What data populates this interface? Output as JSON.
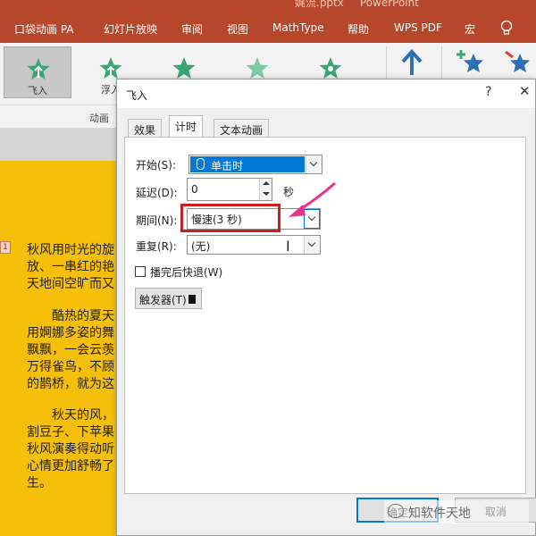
{
  "window": {
    "title_visible": [
      "娓流.pptx",
      "PowerPoint"
    ]
  },
  "menu": {
    "items": [
      "口袋动画 PA",
      "幻灯片放映",
      "审阅",
      "视图",
      "MathType",
      "帮助",
      "WPS PDF",
      "宏"
    ],
    "bar_color": "#b7472a"
  },
  "ribbon": {
    "animations": [
      {
        "label": "飞入",
        "selected": true,
        "icon": "star-icon"
      },
      {
        "label": "浮入",
        "selected": false,
        "icon": "star-icon"
      },
      {
        "label": "",
        "selected": false,
        "icon": "star-icon"
      },
      {
        "label": "",
        "selected": false,
        "icon": "star-icon"
      },
      {
        "label": "",
        "selected": false,
        "icon": "star-icon"
      }
    ],
    "group_label": "动画"
  },
  "slide": {
    "background": "#f5bf0a",
    "anim_tag": "1",
    "paragraphs": [
      "秋风用时光的旋\n放、一串红的艳\n天地间空旷而又",
      "　　酷热的夏天\n用婀娜多姿的舞\n飘飘，一会云羡\n万得雀鸟，不顾\n的鹊桥，就为这",
      "　　秋天的风，\n割豆子、下苹果\n秋风演奏得动听\n心情更加舒畅了\n生。"
    ]
  },
  "dialog": {
    "title": "飞入",
    "help": "?",
    "close": "✕",
    "tabs": [
      {
        "label": "效果",
        "active": false
      },
      {
        "label": "计时",
        "active": true
      },
      {
        "label": "文本动画",
        "active": false
      }
    ],
    "fields": {
      "start_label": "开始(S):",
      "start_value": "单击时",
      "delay_label": "延迟(D):",
      "delay_value": "0",
      "delay_unit": "秒",
      "duration_label": "期间(N):",
      "duration_value": "慢速(3 秒)",
      "repeat_label": "重复(R):",
      "repeat_value": "(无)",
      "rewind_label": "播完后快退(W)",
      "rewind_checked": false,
      "trigger_label": "触发器(T)"
    },
    "buttons": {
      "ok": "确定",
      "cancel": "取消"
    }
  },
  "watermark": {
    "text": "知软件天地"
  },
  "colors": {
    "accent": "#0078d7",
    "highlight_box": "#cc1f1f",
    "arrow": "#e8338f"
  }
}
